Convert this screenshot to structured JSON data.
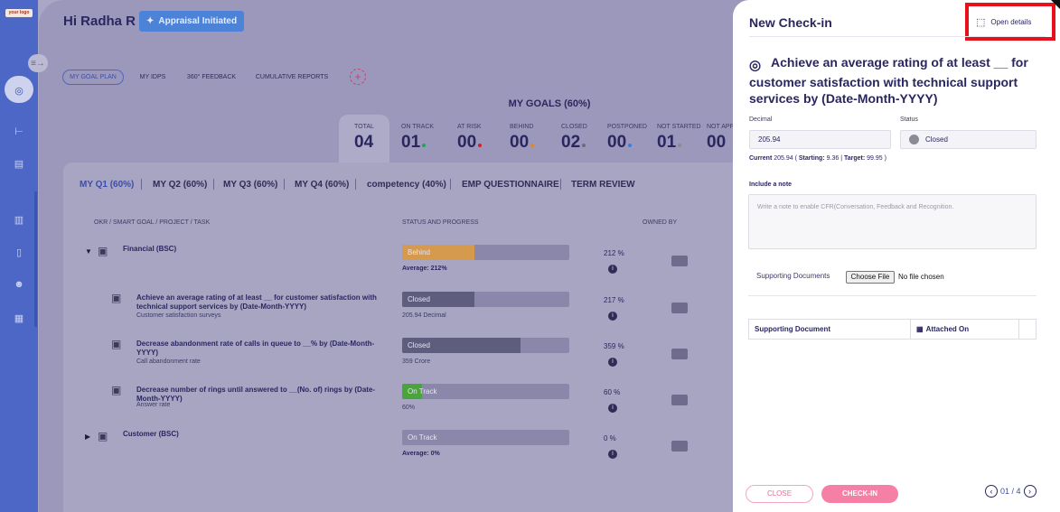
{
  "app": {
    "logo_text": "your logo"
  },
  "sidebar": {
    "icons": [
      "collapse-icon",
      "goals-icon",
      "tree-icon",
      "document-icon",
      "analytics-icon",
      "book-icon",
      "team-icon",
      "report-icon"
    ]
  },
  "header": {
    "greeting": "Hi Radha R",
    "status_badge": "Appraisal Initiated"
  },
  "plan_tabs": [
    "MY GOAL PLAN",
    "MY IDPS",
    "360° FEEDBACK",
    "CUMULATIVE REPORTS"
  ],
  "goals_summary": {
    "title": "MY GOALS (60%)",
    "stats": [
      {
        "label": "TOTAL",
        "value": "04",
        "dot_color": ""
      },
      {
        "label": "ON TRACK",
        "value": "01",
        "dot_color": "#1fa65a"
      },
      {
        "label": "AT RISK",
        "value": "00",
        "dot_color": "#d0202a"
      },
      {
        "label": "BEHIND",
        "value": "00",
        "dot_color": "#e08a1e"
      },
      {
        "label": "CLOSED",
        "value": "02",
        "dot_color": "#6b6b7a"
      },
      {
        "label": "POSTPONED",
        "value": "00",
        "dot_color": "#3b7de0"
      },
      {
        "label": "NOT STARTED",
        "value": "01",
        "dot_color": "#8a8a94"
      },
      {
        "label": "NOT APP",
        "value": "00",
        "dot_color": ""
      }
    ]
  },
  "quarter_tabs": [
    "MY Q1 (60%)",
    "MY Q2 (60%)",
    "MY Q3 (60%)",
    "MY Q4 (60%)",
    "competency (40%)",
    "EMP QUESTIONNAIRE",
    "TERM REVIEW"
  ],
  "table": {
    "headers": [
      "OKR / SMART GOAL / PROJECT / TASK",
      "STATUS AND PROGRESS",
      "OWNED BY"
    ],
    "rows": [
      {
        "toggle": "▼",
        "title": "Financial (BSC)",
        "subtitle": "",
        "status": "Behind",
        "progress": 0.43,
        "fill": "#d59a4e",
        "caption": "Average: 212%",
        "pct": "212 %"
      },
      {
        "toggle": "",
        "title": "Achieve an average rating of at least __ for customer satisfaction with technical support services by (Date-Month-YYYY)",
        "subtitle": "Customer satisfaction surveys",
        "status": "Closed",
        "progress": 0.43,
        "fill": "#5f5d7e",
        "caption": "205.94 Decimal",
        "pct": "217 %"
      },
      {
        "toggle": "",
        "title": "Decrease abandonment rate of calls in queue to __% by (Date-Month-YYYY)",
        "subtitle": "Call abandonment rate",
        "status": "Closed",
        "progress": 0.71,
        "fill": "#5f5d7e",
        "caption": "359 Crore",
        "pct": "359 %"
      },
      {
        "toggle": "",
        "title": "Decrease number of rings until answered to __(No. of) rings by (Date-Month-YYYY)",
        "subtitle": "Answer rate",
        "status": "On Track",
        "progress": 0.12,
        "fill": "#4aa43c",
        "caption": "60%",
        "pct": "60 %"
      },
      {
        "toggle": "▶",
        "title": "Customer (BSC)",
        "subtitle": "",
        "status": "On Track",
        "progress": 0.0,
        "fill": "#4aa43c",
        "caption": "Average: 0%",
        "pct": "0 %"
      }
    ]
  },
  "checkin": {
    "title": "New Check-in",
    "open_details": "Open details",
    "goal_title": "Achieve an average rating of at least __ for customer satisfaction with technical support services by (Date-Month-YYYY)",
    "decimal_label": "Decimal",
    "decimal_value": "205.94",
    "status_label": "Status",
    "status_value": "Closed",
    "current_prefix": "Current",
    "current_value": "205.94",
    "starting_label": "Starting:",
    "starting_value": "9.36",
    "target_label": "Target:",
    "target_value": "99.95",
    "note_label": "Include a note",
    "note_placeholder": "Write a note to enable CFR(Conversation, Feedback and Recognition.",
    "supporting_docs_label": "Supporting Documents",
    "choose_file": "Choose File",
    "no_file": "No file chosen",
    "doc_table_headers": [
      "Supporting Document",
      "Attached On"
    ],
    "close_label": "CLOSE",
    "checkin_label": "CHECK-IN",
    "pager": "01 / 4"
  }
}
